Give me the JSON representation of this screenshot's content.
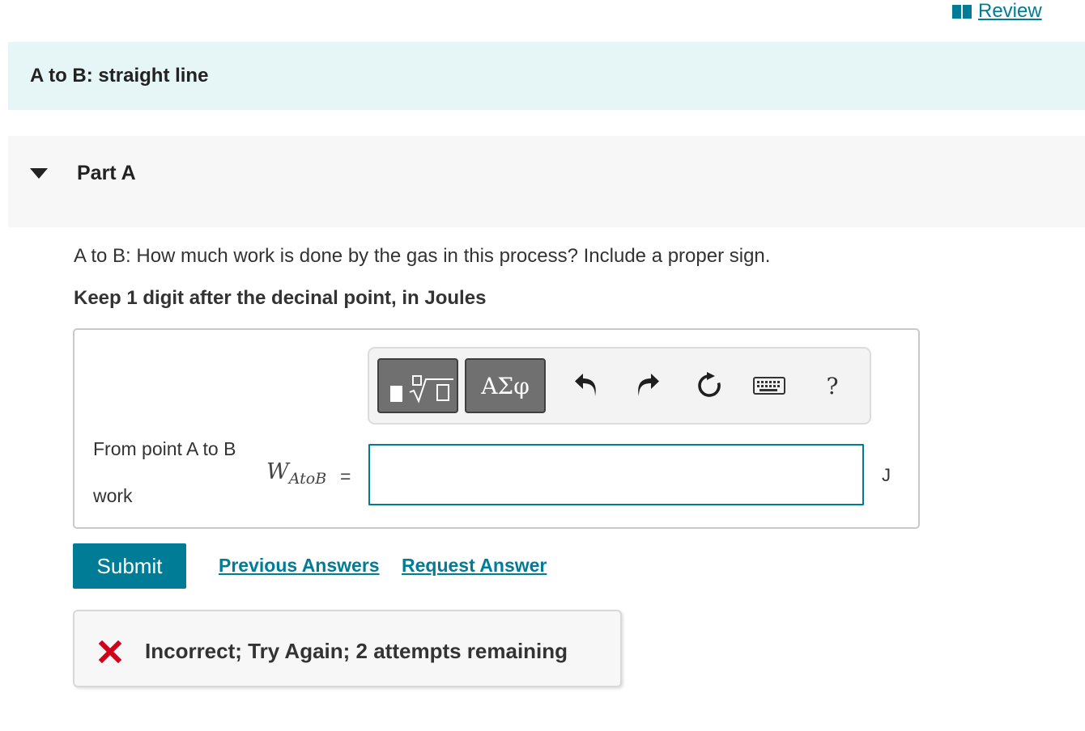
{
  "header": {
    "review_label": "Review"
  },
  "intro": {
    "title": "A to B: straight line"
  },
  "part": {
    "title": "Part A",
    "question": "A to B: How much work is done by the gas in this process? Include a proper sign.",
    "instruction": "Keep 1 digit after the decinal point, in Joules"
  },
  "toolbar": {
    "greek_label": "ΑΣφ",
    "help_label": "?",
    "icons": [
      "templates-icon",
      "greek-symbols-icon",
      "undo-icon",
      "redo-icon",
      "reset-icon",
      "keyboard-icon",
      "help-icon"
    ]
  },
  "answer": {
    "label_line1": "From point A to B",
    "label_line2": "work",
    "variable_main": "W",
    "variable_sub": "AtoB",
    "equals": "=",
    "value": "",
    "unit": "J"
  },
  "actions": {
    "submit_label": "Submit",
    "previous_answers_label": "Previous Answers",
    "request_answer_label": "Request Answer"
  },
  "feedback": {
    "message": "Incorrect; Try Again; 2 attempts remaining",
    "status_color": "#d0021b"
  },
  "colors": {
    "accent": "#007c97",
    "intro_bg": "#e6f5f5"
  }
}
